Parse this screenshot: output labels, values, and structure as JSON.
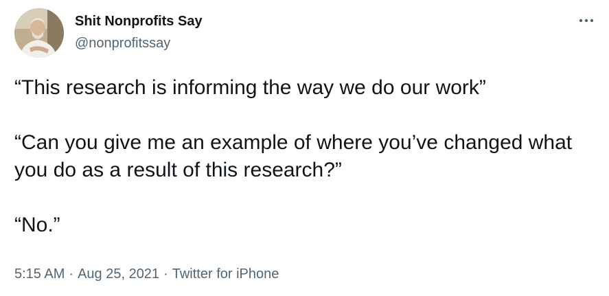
{
  "author": {
    "display_name": "Shit Nonprofits Say",
    "handle": "@nonprofitssay"
  },
  "tweet": {
    "paragraphs": [
      "“This research is informing the way we do our work”",
      "“Can you give me an example of where you’ve changed what you do as a result of this research?”",
      "“No.”"
    ]
  },
  "meta": {
    "time": "5:15 AM",
    "separator": "·",
    "date": "Aug 25, 2021",
    "source": "Twitter for iPhone"
  },
  "icons": {
    "more": "more-horizontal-icon"
  },
  "colors": {
    "text": "#0f1419",
    "secondary": "#536471"
  }
}
